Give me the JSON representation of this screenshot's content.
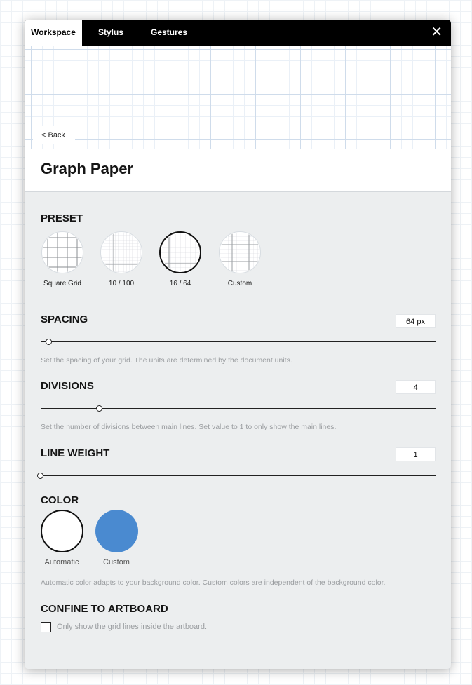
{
  "tabs": [
    {
      "label": "Workspace",
      "active": true
    },
    {
      "label": "Stylus",
      "active": false
    },
    {
      "label": "Gestures",
      "active": false
    }
  ],
  "close_icon": "close-icon",
  "back_label": "< Back",
  "page_title": "Graph Paper",
  "preset": {
    "title": "PRESET",
    "options": [
      {
        "label": "Square Grid",
        "selected": false
      },
      {
        "label": "10 / 100",
        "selected": false
      },
      {
        "label": "16 / 64",
        "selected": true
      },
      {
        "label": "Custom",
        "selected": false
      }
    ]
  },
  "spacing": {
    "title": "SPACING",
    "value": "64 px",
    "help": "Set the spacing of your grid. The units are determined by the document units."
  },
  "divisions": {
    "title": "DIVISIONS",
    "value": "4",
    "help": "Set the number of divisions between main lines. Set value to 1 to only show the main lines."
  },
  "line_weight": {
    "title": "LINE WEIGHT",
    "value": "1"
  },
  "color": {
    "title": "COLOR",
    "automatic_label": "Automatic",
    "custom_label": "Custom",
    "custom_color": "#4a8ad0",
    "selected": "Automatic",
    "help": "Automatic color adapts to your background color. Custom colors are independent of the background color."
  },
  "confine": {
    "title": "CONFINE TO ARTBOARD",
    "checkbox_label": "Only show the grid lines inside the artboard.",
    "checked": false
  }
}
